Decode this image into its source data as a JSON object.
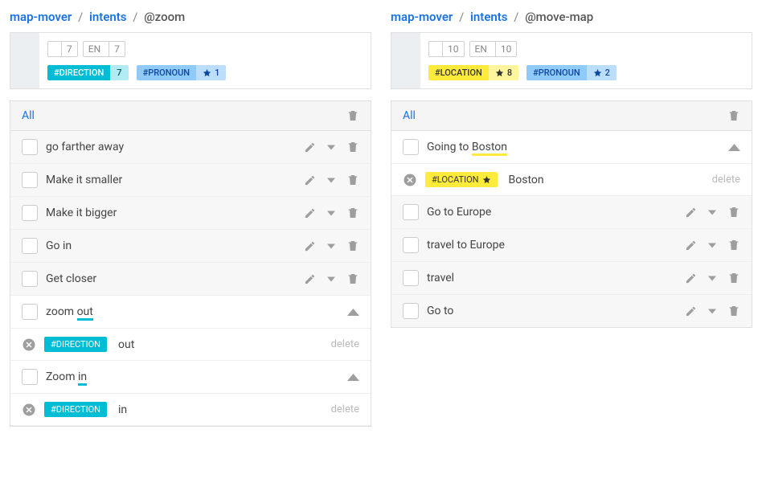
{
  "left": {
    "breadcrumb": {
      "root": "map-mover",
      "mid": "intents",
      "cur": "@zoom"
    },
    "stats": {
      "chat": "7",
      "lang": "EN",
      "langCount": "7"
    },
    "tags": [
      {
        "kind": "teal",
        "name": "#DIRECTION",
        "star": false,
        "count": "7"
      },
      {
        "kind": "blue",
        "name": "#PRONOUN",
        "star": true,
        "count": "1"
      }
    ],
    "allLabel": "All",
    "rows": [
      {
        "text": "go farther away",
        "expanded": false
      },
      {
        "text": "Make it smaller",
        "expanded": false
      },
      {
        "text": "Make it bigger",
        "expanded": false
      },
      {
        "text": "Go in",
        "expanded": false
      },
      {
        "text": "Get closer",
        "expanded": false
      },
      {
        "text_pre": "zoom ",
        "text_hl": "out",
        "expanded": true,
        "anno": {
          "kind": "teal",
          "name": "#DIRECTION",
          "value": "out"
        }
      },
      {
        "text_pre": "Zoom ",
        "text_hl": "in",
        "expanded": true,
        "anno": {
          "kind": "teal",
          "name": "#DIRECTION",
          "value": "in"
        }
      }
    ],
    "deleteLabel": "delete"
  },
  "right": {
    "breadcrumb": {
      "root": "map-mover",
      "mid": "intents",
      "cur": "@move-map"
    },
    "stats": {
      "chat": "10",
      "lang": "EN",
      "langCount": "10"
    },
    "tags": [
      {
        "kind": "yellow",
        "name": "#LOCATION",
        "star": true,
        "count": "8"
      },
      {
        "kind": "blue",
        "name": "#PRONOUN",
        "star": true,
        "count": "2"
      }
    ],
    "allLabel": "All",
    "rows": [
      {
        "text_pre": "Going to ",
        "text_hl": "Boston",
        "expanded": true,
        "anno": {
          "kind": "yellow",
          "name": "#LOCATION",
          "star": true,
          "value": "Boston"
        }
      },
      {
        "text": "Go to Europe",
        "expanded": false
      },
      {
        "text": "travel to Europe",
        "expanded": false
      },
      {
        "text": "travel",
        "expanded": false
      },
      {
        "text": "Go to",
        "expanded": false
      }
    ],
    "deleteLabel": "delete"
  }
}
